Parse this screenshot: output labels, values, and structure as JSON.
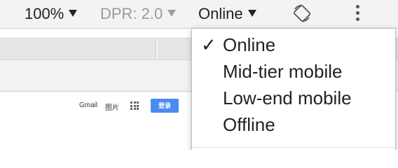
{
  "toolbar": {
    "zoom": "100%",
    "dpr": "DPR: 2.0",
    "throttle": "Online",
    "rotate_icon": "rotate-icon",
    "more_icon": "more-vertical-icon"
  },
  "page": {
    "gmail": "Gmail",
    "images": "图片",
    "apps_icon": "apps-grid-icon",
    "signin": "登录"
  },
  "menu": {
    "selected": "Online",
    "check": "✓",
    "items": [
      "Online",
      "Mid-tier mobile",
      "Low-end mobile",
      "Offline"
    ]
  }
}
